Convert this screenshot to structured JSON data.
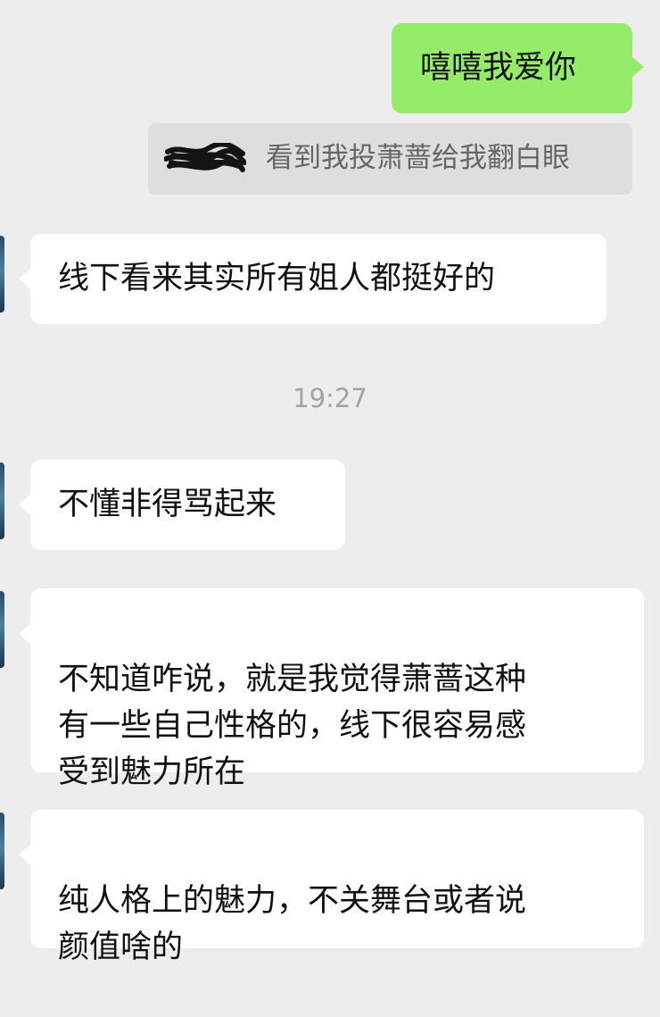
{
  "chat": {
    "messages": [
      {
        "direction": "outgoing",
        "text": "嘻嘻我爱你"
      },
      {
        "direction": "incoming",
        "text": "线下看来其实所有姐人都挺好的"
      },
      {
        "direction": "incoming",
        "text": "不懂非得骂起来"
      },
      {
        "direction": "incoming",
        "text": "不知道咋说，就是我觉得萧蔷这种\n有一些自己性格的，线下很容易感\n受到魅力所在"
      },
      {
        "direction": "incoming",
        "text": "纯人格上的魅力，不关舞台或者说\n颜值啥的"
      }
    ],
    "quote": {
      "text": "看到我投萧蔷给我翻白眼"
    },
    "timestamp": "19:27"
  }
}
